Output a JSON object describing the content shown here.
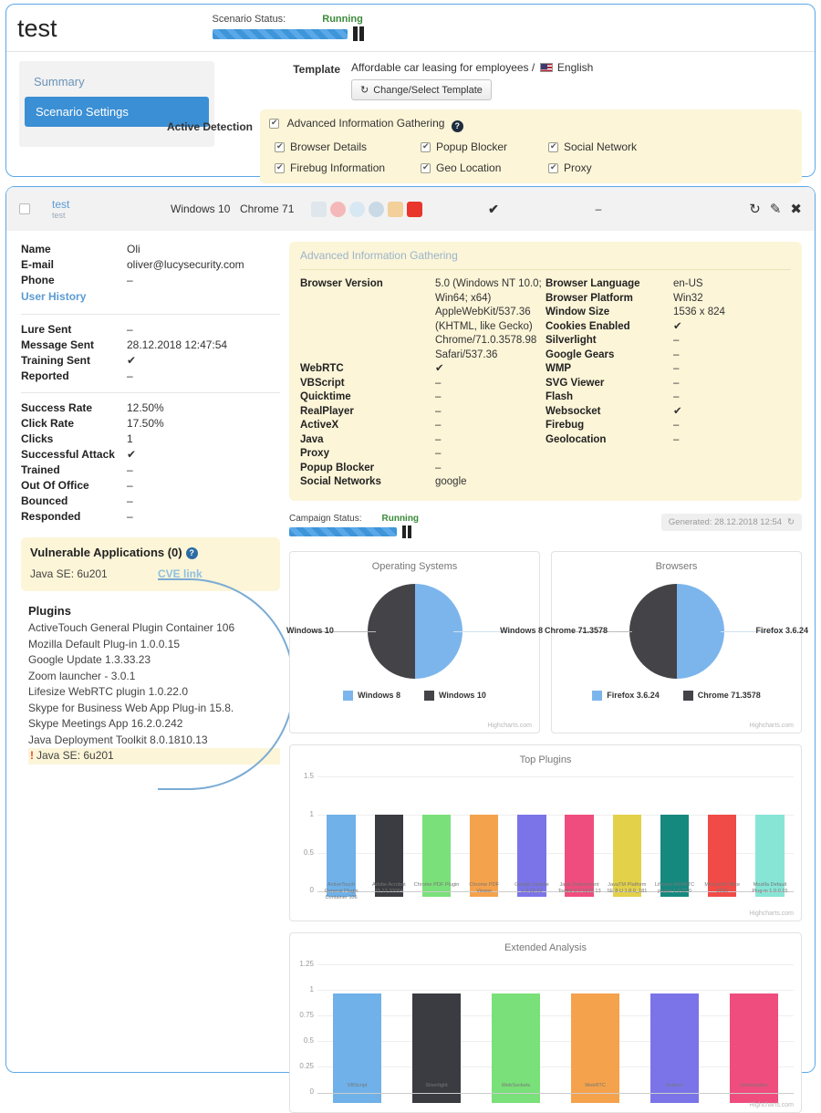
{
  "scenario": {
    "title": "test",
    "status_label": "Scenario Status:",
    "status_value": "Running",
    "pause_icon": "pause-icon"
  },
  "sidebar": {
    "items": [
      {
        "label": "Summary",
        "active": false
      },
      {
        "label": "Scenario Settings",
        "active": true
      }
    ]
  },
  "settings": {
    "template_label": "Template",
    "template_value": "Affordable car leasing for employees /",
    "template_language": "English",
    "change_button": "Change/Select Template",
    "change_button_icon": "refresh-icon",
    "active_detection_label": "Active Detection",
    "primary_option": "Advanced Information Gathering",
    "help_icon": "help-icon",
    "options": [
      "Browser Details",
      "Popup Blocker",
      "Social Network",
      "Firebug Information",
      "Geo Location",
      "Proxy"
    ]
  },
  "record_header": {
    "name": "test",
    "subname": "test",
    "os": "Windows 10",
    "browser": "Chrome 71",
    "tick": "✔",
    "dash": "–",
    "icons": [
      "java-icon",
      "acrobat-icon",
      "quicktime-icon",
      "search-icon",
      "media-player-icon",
      "pdf-icon"
    ],
    "actions": [
      "refresh-icon",
      "edit-icon",
      "close-icon"
    ]
  },
  "recipient": {
    "rows": [
      {
        "k": "Name",
        "v": "Oli"
      },
      {
        "k": "E-mail",
        "v": "oliver@lucysecurity.com"
      },
      {
        "k": "Phone",
        "v": "–"
      }
    ],
    "history_link": "User History",
    "activity": [
      {
        "k": "Lure Sent",
        "v": "–"
      },
      {
        "k": "Message Sent",
        "v": "28.12.2018 12:47:54"
      },
      {
        "k": "Training Sent",
        "v": "✔"
      },
      {
        "k": "Reported",
        "v": "–"
      }
    ],
    "stats": [
      {
        "k": "Success Rate",
        "v": "12.50%"
      },
      {
        "k": "Click Rate",
        "v": "17.50%"
      },
      {
        "k": "Clicks",
        "v": "1"
      },
      {
        "k": "Successful Attack",
        "v": "✔"
      },
      {
        "k": "Trained",
        "v": "–"
      },
      {
        "k": "Out Of Office",
        "v": "–"
      },
      {
        "k": "Bounced",
        "v": "–"
      },
      {
        "k": "Responded",
        "v": "–"
      }
    ]
  },
  "vulnerable": {
    "title": "Vulnerable Applications (0)",
    "help_icon": "help-icon",
    "app": "Java SE: 6u201",
    "cve_link": "CVE link"
  },
  "plugins": {
    "title": "Plugins",
    "items": [
      "ActiveTouch General Plugin Container 106",
      "Mozilla Default Plug-in 1.0.0.15",
      "Google Update 1.3.33.23",
      "Zoom launcher - 3.0.1",
      "Lifesize WebRTC plugin 1.0.22.0",
      "Skype for Business Web App Plug-in 15.8.",
      "Skype Meetings App 16.2.0.242",
      "Java Deployment Toolkit 8.0.1810.13"
    ],
    "warn_item": "Java SE: 6u201",
    "warn_icon": "warning-icon"
  },
  "aig": {
    "title": "Advanced Information Gathering",
    "left": [
      {
        "k": "Browser Version",
        "v": "5.0 (Windows NT 10.0; Win64; x64) AppleWebKit/537.36 (KHTML, like Gecko) Chrome/71.0.3578.98 Safari/537.36"
      },
      {
        "k": "WebRTC",
        "v": "✔"
      },
      {
        "k": "VBScript",
        "v": "–"
      },
      {
        "k": "Quicktime",
        "v": "–"
      },
      {
        "k": "RealPlayer",
        "v": "–"
      },
      {
        "k": "ActiveX",
        "v": "–"
      },
      {
        "k": "Java",
        "v": "–"
      },
      {
        "k": "Proxy",
        "v": "–"
      },
      {
        "k": "Popup Blocker",
        "v": "–"
      },
      {
        "k": "Social Networks",
        "v": "google"
      }
    ],
    "right": [
      {
        "k": "Browser Language",
        "v": "en-US"
      },
      {
        "k": "Browser Platform",
        "v": "Win32"
      },
      {
        "k": "Window Size",
        "v": "1536 x 824"
      },
      {
        "k": "Cookies Enabled",
        "v": "✔"
      },
      {
        "k": "Silverlight",
        "v": "–"
      },
      {
        "k": "Google Gears",
        "v": "–"
      },
      {
        "k": "WMP",
        "v": "–"
      },
      {
        "k": "SVG Viewer",
        "v": "–"
      },
      {
        "k": "Flash",
        "v": "–"
      },
      {
        "k": "Websocket",
        "v": "✔"
      },
      {
        "k": "Firebug",
        "v": "–"
      },
      {
        "k": "Geolocation",
        "v": "–"
      }
    ]
  },
  "campaign": {
    "status_label": "Campaign Status:",
    "status_value": "Running",
    "generated": "Generated: 28.12.2018 12:54",
    "refresh_icon": "refresh-icon"
  },
  "colors": {
    "accent": "#3b8fd4",
    "panel_border": "#5aa8e8",
    "highlight_bg": "#fcf5d8",
    "running_green": "#3a8a3a",
    "pie_blue": "#7cb5ec",
    "pie_dark": "#434348"
  },
  "chart_data": [
    {
      "type": "pie",
      "title": "Operating Systems",
      "slices": [
        {
          "name": "Windows 8",
          "value": 50,
          "color": "#7cb5ec"
        },
        {
          "name": "Windows 10",
          "value": 50,
          "color": "#434348"
        }
      ],
      "legend": [
        "Windows 8",
        "Windows 10"
      ],
      "legend_position": "bottom",
      "credit": "Highcharts.com"
    },
    {
      "type": "pie",
      "title": "Browsers",
      "slices": [
        {
          "name": "Firefox 3.6.24",
          "value": 50,
          "color": "#7cb5ec"
        },
        {
          "name": "Chrome 71.3578",
          "value": 50,
          "color": "#434348"
        }
      ],
      "legend": [
        "Firefox 3.6.24",
        "Chrome 71.3578"
      ],
      "legend_position": "bottom",
      "credit": "Highcharts.com"
    },
    {
      "type": "bar",
      "title": "Top Plugins",
      "categories": [
        "ActiveTouch General Plugin Container 106",
        "Adobe Acrobat 15.13.20064",
        "Chrome PDF Plugin",
        "Chrome PDF Viewer",
        "Google Update 1.3.33.23",
        "Java Deployment Toolkit 8.0.1810.13",
        "JavaTM Platform SE 8 U 1.8.0_181",
        "Lifesize WebRTC plugin 1.0.22.0",
        "Microsoft Office 2016",
        "Mozilla Default Plug-in 1.0.0.15"
      ],
      "values": [
        1,
        1,
        1,
        1,
        1,
        1,
        1,
        1,
        1,
        1
      ],
      "colors": [
        "#6fb1e8",
        "#3b3c41",
        "#7ae07a",
        "#f5a košice",
        "#7b74e8",
        "#ef4d7e",
        "#e3d14a",
        "#16897f",
        "#f04b47",
        "#87e5d6"
      ],
      "bar_colors": [
        "#6fb1e8",
        "#3b3c41",
        "#7ae07a",
        "#f5a24c",
        "#7b74e8",
        "#ef4d7e",
        "#e3d14a",
        "#16897f",
        "#f04b47",
        "#87e5d6"
      ],
      "yticks": [
        "0",
        "0.5",
        "1",
        "1.5"
      ],
      "ylim": [
        0,
        1.5
      ],
      "xlabel": "",
      "ylabel": "",
      "grid": true,
      "credit": "Highcharts.com"
    },
    {
      "type": "bar",
      "title": "Extended Analysis",
      "categories": [
        "VBScript",
        "Silverlight",
        "WebSockets",
        "WebRTC",
        "ActiveX",
        "Geolocation"
      ],
      "values": [
        1,
        1,
        1,
        1,
        1,
        1
      ],
      "bar_colors": [
        "#6fb1e8",
        "#3b3c41",
        "#7ae07a",
        "#f5a24c",
        "#7b74e8",
        "#ef4d7e"
      ],
      "yticks": [
        "0",
        "0.25",
        "0.5",
        "0.75",
        "1",
        "1.25"
      ],
      "ylim": [
        0,
        1.25
      ],
      "xlabel": "",
      "ylabel": "",
      "grid": true,
      "credit": "Highcharts.com"
    }
  ]
}
